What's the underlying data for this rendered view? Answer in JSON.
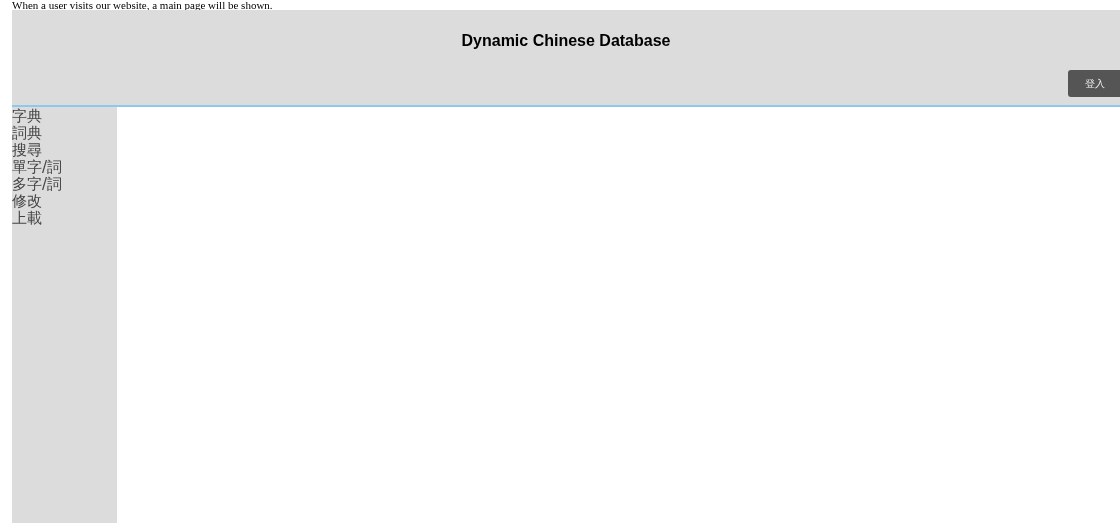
{
  "caption": "When a user visits our website, a main page will be shown.",
  "header": {
    "title": "Dynamic Chinese Database",
    "login_button": "登入"
  },
  "sidebar": {
    "items": [
      {
        "label": "字典"
      },
      {
        "label": "詞典"
      },
      {
        "label": "搜尋"
      },
      {
        "label": "單字/詞"
      },
      {
        "label": "多字/詞"
      },
      {
        "label": "修改"
      },
      {
        "label": "上載"
      }
    ]
  }
}
